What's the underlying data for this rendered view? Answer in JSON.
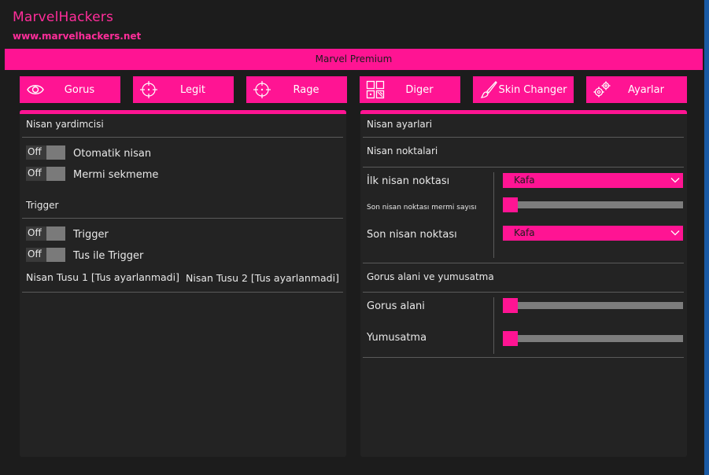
{
  "brand": {
    "title": "MarvelHackers",
    "url": "www.marvelhackers.net"
  },
  "window_title": "Marvel Premium",
  "colors": {
    "accent": "#ff1493",
    "panel": "#232323",
    "background": "#1c1c1c",
    "toggle_track": "#7a7a7a"
  },
  "tabs": [
    {
      "label": "Gorus",
      "icon": "eye-icon"
    },
    {
      "label": "Legit",
      "icon": "crosshair-icon"
    },
    {
      "label": "Rage",
      "icon": "crosshair-icon"
    },
    {
      "label": "Diger",
      "icon": "grid-icon"
    },
    {
      "label": "Skin Changer",
      "icon": "paintbrush-icon"
    },
    {
      "label": "Ayarlar",
      "icon": "gears-icon"
    }
  ],
  "left": {
    "aim_assist_title": "Nisan yardimcisi",
    "toggles": [
      {
        "state": "Off",
        "label": "Otomatik nisan"
      },
      {
        "state": "Off",
        "label": "Mermi sekmeme"
      }
    ],
    "trigger_title": "Trigger",
    "trigger_toggles": [
      {
        "state": "Off",
        "label": "Trigger"
      },
      {
        "state": "Off",
        "label": "Tus ile Trigger"
      }
    ],
    "key1": "Nisan Tusu 1 [Tus ayarlanmadi]",
    "key2": "Nisan Tusu 2 [Tus ayarlanmadi]"
  },
  "right": {
    "aim_settings_title": "Nisan ayarlari",
    "aim_points_title": "Nisan noktalari",
    "first_point_label": "İlk nisan noktası",
    "first_point_value": "Kafa",
    "bullet_count_label": "Son nisan noktası mermi sayısı",
    "bullet_count_value": 0,
    "last_point_label": "Son nisan noktası",
    "last_point_value": "Kafa",
    "fov_smooth_title": "Gorus alani ve yumusatma",
    "fov_label": "Gorus alani",
    "fov_value": 0,
    "smooth_label": "Yumusatma",
    "smooth_value": 0
  }
}
